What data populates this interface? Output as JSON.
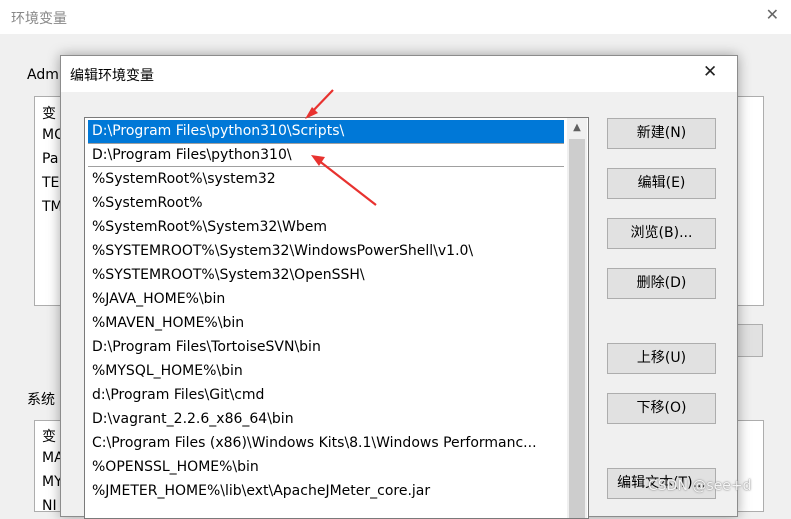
{
  "background_window": {
    "title": "环境变量",
    "close_glyph": "✕",
    "user_group_label": "Adm",
    "user_vars_partial": [
      "变",
      "MC",
      "Pa",
      "TE",
      "TM"
    ],
    "system_group_label": "系统",
    "system_vars_partial": [
      "变",
      "MA",
      "MY",
      "NI"
    ]
  },
  "dialog": {
    "title": "编辑环境变量",
    "close_glyph": "✕",
    "paths": [
      "D:\\Program Files\\python310\\Scripts\\",
      "D:\\Program Files\\python310\\",
      "%SystemRoot%\\system32",
      "%SystemRoot%",
      "%SystemRoot%\\System32\\Wbem",
      "%SYSTEMROOT%\\System32\\WindowsPowerShell\\v1.0\\",
      "%SYSTEMROOT%\\System32\\OpenSSH\\",
      "%JAVA_HOME%\\bin",
      "%MAVEN_HOME%\\bin",
      "D:\\Program Files\\TortoiseSVN\\bin",
      "%MYSQL_HOME%\\bin",
      "d:\\Program Files\\Git\\cmd",
      "D:\\vagrant_2.2.6_x86_64\\bin",
      "C:\\Program Files (x86)\\Windows Kits\\8.1\\Windows Performanc...",
      "%OPENSSL_HOME%\\bin",
      "%JMETER_HOME%\\lib\\ext\\ApacheJMeter_core.jar"
    ],
    "selected_index": 0,
    "buttons": {
      "new": "新建(N)",
      "edit": "编辑(E)",
      "browse": "浏览(B)...",
      "delete": "删除(D)",
      "move_up": "上移(U)",
      "move_down": "下移(O)",
      "edit_text": "编辑文本(T)..."
    }
  },
  "watermark": "CSDN @see+d",
  "colors": {
    "selection": "#0078d7",
    "annotation_arrow": "#e8322f"
  }
}
